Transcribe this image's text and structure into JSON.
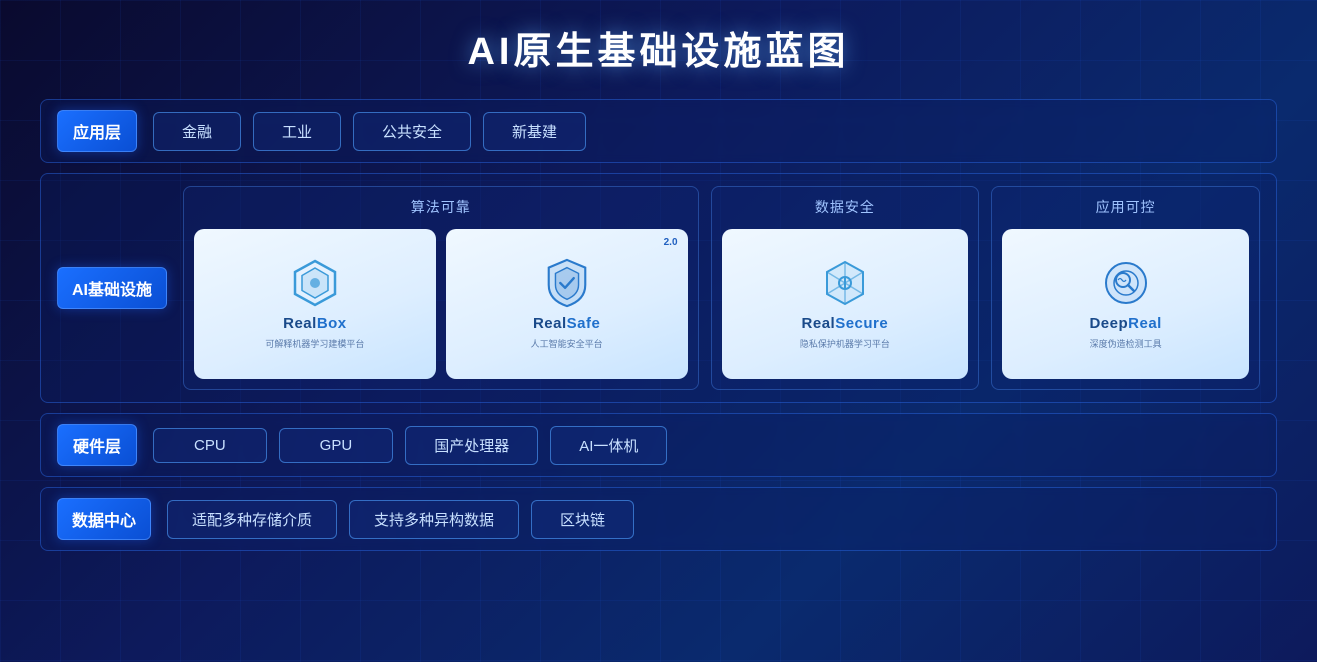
{
  "title": "AI原生基础设施蓝图",
  "layers": {
    "application": {
      "label": "应用层",
      "items": [
        "金融",
        "工业",
        "公共安全",
        "新基建"
      ]
    },
    "ai_infra": {
      "label": "AI基础设施",
      "groups": [
        {
          "title": "算法可靠",
          "products": [
            {
              "name_prefix": "Real",
              "name_suffix": "Box",
              "desc": "可解释机器学习建模平台",
              "icon_type": "hexagon"
            },
            {
              "name_prefix": "Real",
              "name_suffix": "Safe",
              "desc": "人工智能安全平台",
              "badge": "2.0",
              "icon_type": "shield"
            }
          ]
        },
        {
          "title": "数据安全",
          "products": [
            {
              "name_prefix": "Real",
              "name_suffix": "Secure",
              "desc": "隐私保护机器学习平台",
              "icon_type": "cube"
            }
          ]
        },
        {
          "title": "应用可控",
          "products": [
            {
              "name_prefix": "Deep",
              "name_suffix": "Real",
              "desc": "深度伪造检测工具",
              "icon_type": "deepreal"
            }
          ]
        }
      ]
    },
    "hardware": {
      "label": "硬件层",
      "items": [
        "CPU",
        "GPU",
        "国产处理器",
        "AI一体机"
      ]
    },
    "datacenter": {
      "label": "数据中心",
      "items": [
        "适配多种存储介质",
        "支持多种异构数据",
        "区块链"
      ]
    }
  }
}
